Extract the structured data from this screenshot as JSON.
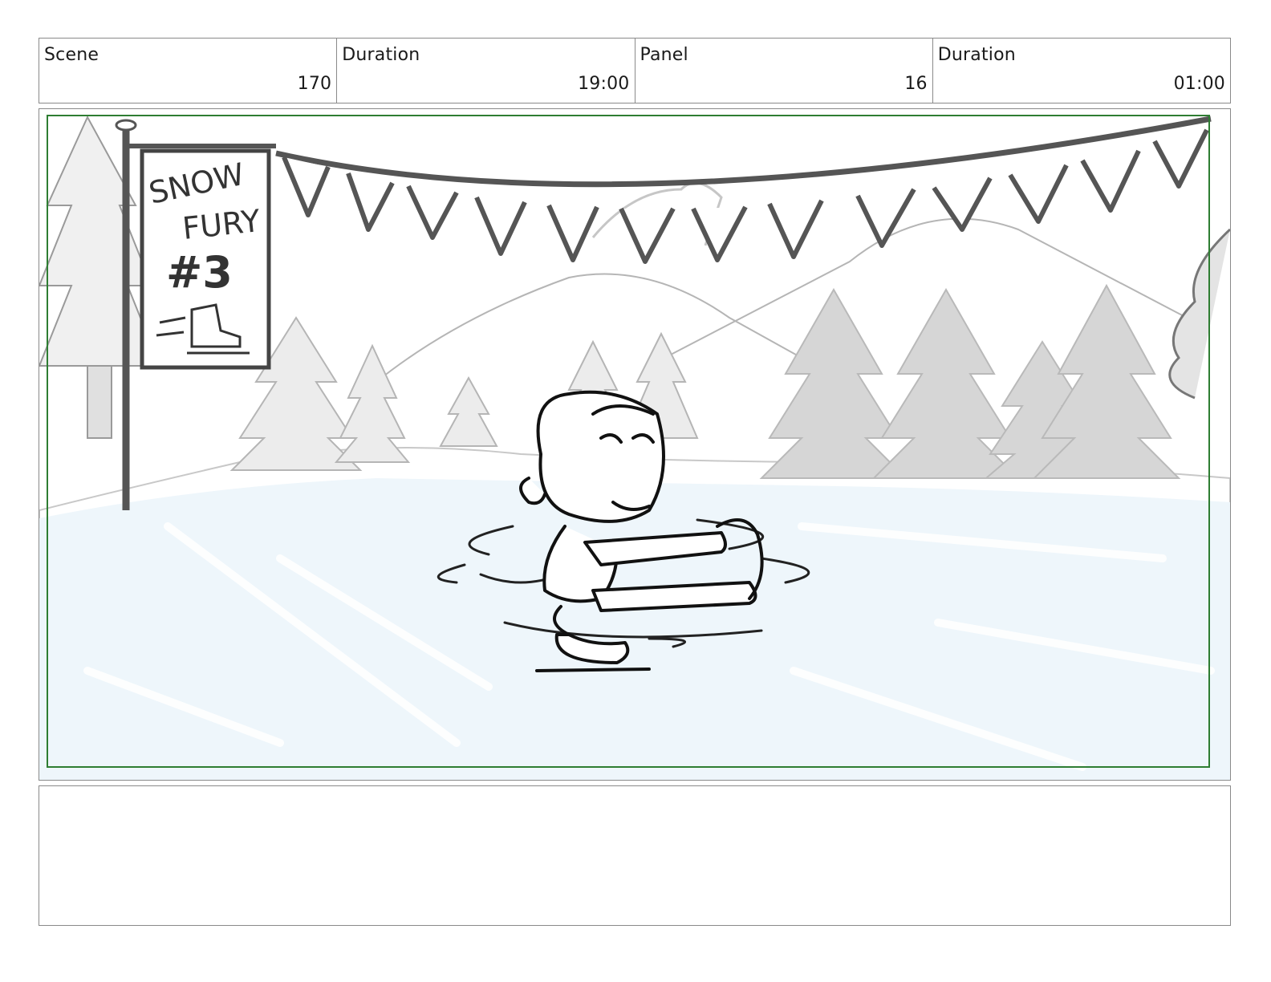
{
  "header": {
    "cells": [
      {
        "label": "Scene",
        "value": "170"
      },
      {
        "label": "Duration",
        "value": "19:00"
      },
      {
        "label": "Panel",
        "value": "16"
      },
      {
        "label": "Duration",
        "value": "01:00"
      }
    ]
  },
  "panel": {
    "sign": {
      "line1": "SNOW",
      "line2": "FURY",
      "line3": "#3"
    },
    "safe_frame_color": "#2e7d32",
    "ice_color": "#eef6fb"
  },
  "notes": {
    "text": ""
  }
}
